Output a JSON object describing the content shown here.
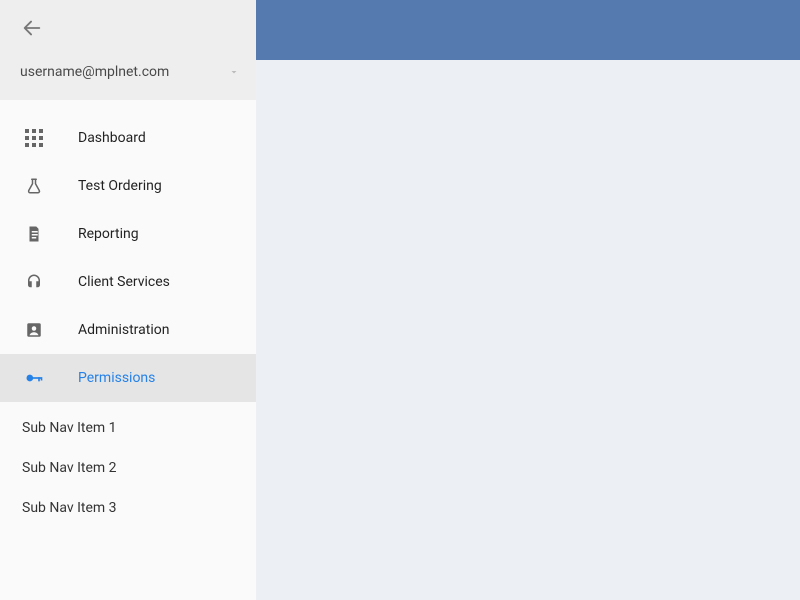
{
  "user": {
    "email": "username@mplnet.com"
  },
  "sidebar": {
    "items": [
      {
        "label": "Dashboard"
      },
      {
        "label": "Test Ordering"
      },
      {
        "label": "Reporting"
      },
      {
        "label": "Client Services"
      },
      {
        "label": "Administration"
      },
      {
        "label": "Permissions"
      }
    ],
    "sub_items": [
      {
        "label": "Sub Nav Item 1"
      },
      {
        "label": "Sub Nav Item 2"
      },
      {
        "label": "Sub Nav Item 3"
      }
    ]
  },
  "colors": {
    "topbar": "#547aaf",
    "accent": "#2682e7",
    "sidebar_bg": "#fafafa",
    "active_bg": "#e5e5e5"
  }
}
